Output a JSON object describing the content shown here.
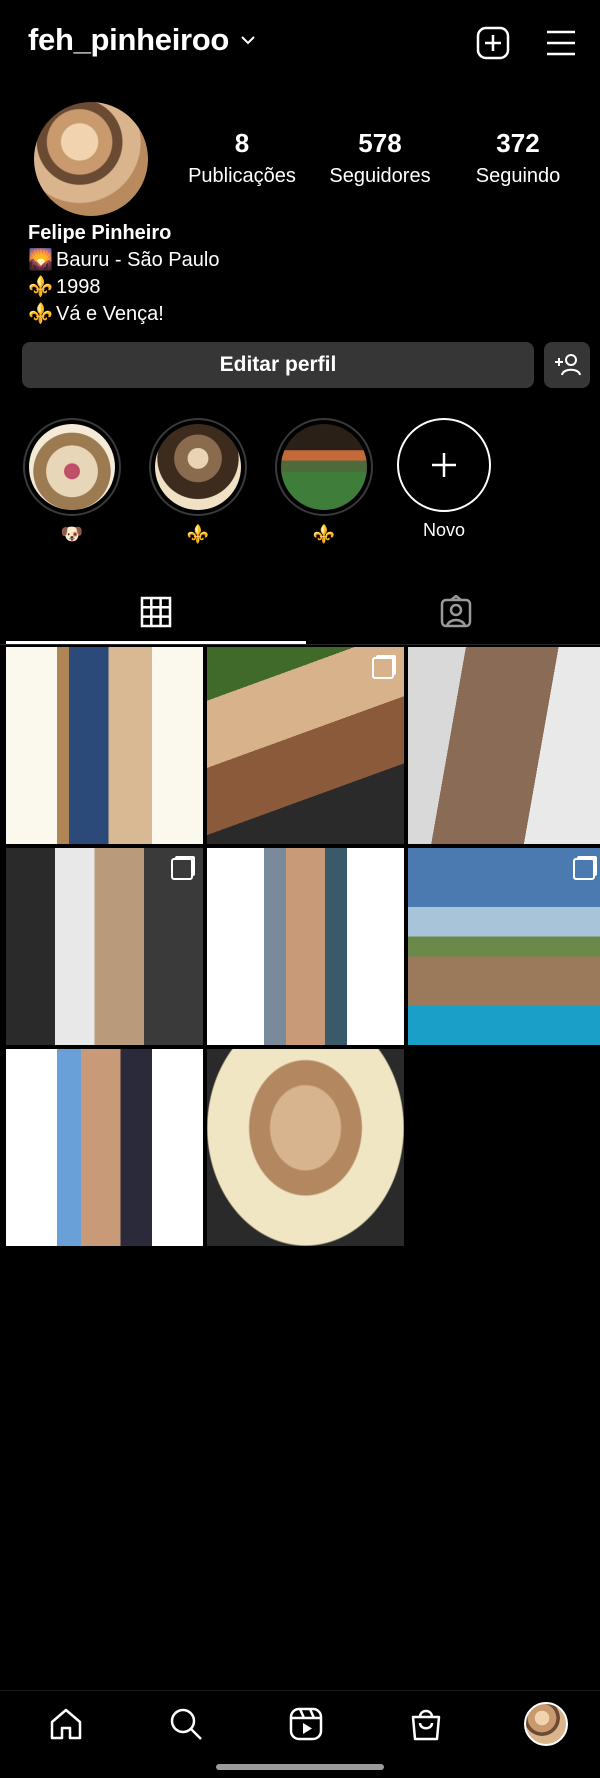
{
  "header": {
    "username": "feh_pinheiroo",
    "icons": [
      "chevron-down-icon",
      "new-post-icon",
      "menu-icon"
    ]
  },
  "profile": {
    "posts_count": "8",
    "posts_label": "Publicações",
    "followers_count": "578",
    "followers_label": "Seguidores",
    "following_count": "372",
    "following_label": "Seguindo",
    "name": "Felipe Pinheiro",
    "bio_lines": [
      {
        "emoji": "🌄",
        "text": "Bauru - São Paulo"
      },
      {
        "emoji": "⚜️",
        "text": "1998"
      },
      {
        "emoji": "⚜️",
        "text": "Vá e Vença!"
      }
    ]
  },
  "actions": {
    "edit_label": "Editar perfil"
  },
  "highlights": [
    {
      "caption": "🐶"
    },
    {
      "caption": "⚜️"
    },
    {
      "caption": "⚜️"
    },
    {
      "caption": "Novo"
    }
  ],
  "tabs": [
    "grid-icon",
    "tagged-icon"
  ],
  "grid": [
    {
      "multi": false
    },
    {
      "multi": true
    },
    {
      "multi": false
    },
    {
      "multi": true
    },
    {
      "multi": false
    },
    {
      "multi": true
    },
    {
      "multi": false
    },
    {
      "multi": false
    }
  ],
  "nav": [
    "home-icon",
    "search-icon",
    "reels-icon",
    "shop-icon",
    "profile-avatar"
  ],
  "colors": {
    "background": "#000000",
    "button": "#363636",
    "text": "#ffffff"
  }
}
